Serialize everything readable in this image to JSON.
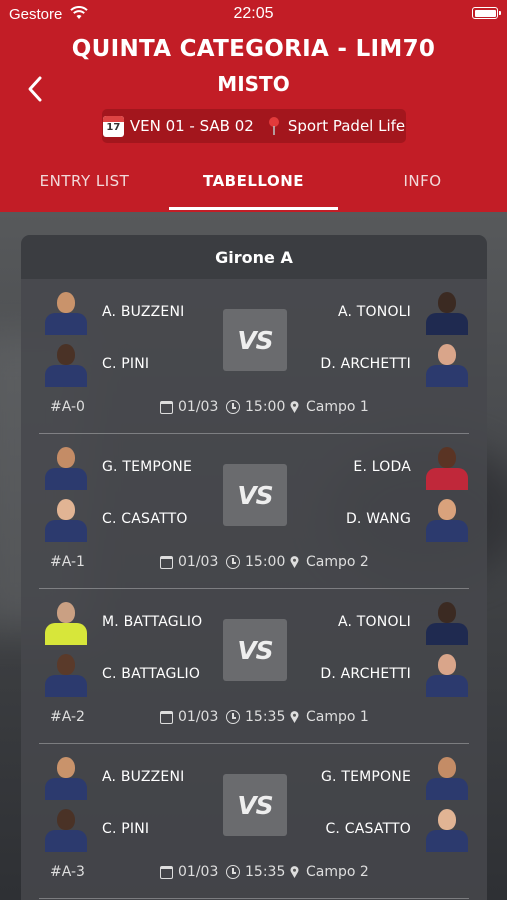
{
  "status": {
    "carrier": "Gestore",
    "time": "22:05"
  },
  "header": {
    "title": "QUINTA CATEGORIA - LIM70",
    "subtitle": "MISTO",
    "calendar_day": "17",
    "dates": "VEN 01 - SAB 02",
    "venue": "Sport Padel Life"
  },
  "tabs": [
    "ENTRY LIST",
    "TABELLONE",
    "INFO"
  ],
  "group": {
    "title": "Girone A"
  },
  "vs_label": "VS",
  "matches": [
    {
      "code": "#A-0",
      "date": "01/03",
      "time": "15:00",
      "court": "Campo 1",
      "left": [
        "A. BUZZENI",
        "C. PINI"
      ],
      "right": [
        "A. TONOLI",
        "D. ARCHETTI"
      ]
    },
    {
      "code": "#A-1",
      "date": "01/03",
      "time": "15:00",
      "court": "Campo 2",
      "left": [
        "G. TEMPONE",
        "C. CASATTO"
      ],
      "right": [
        "E. LODA",
        "D. WANG"
      ]
    },
    {
      "code": "#A-2",
      "date": "01/03",
      "time": "15:35",
      "court": "Campo 1",
      "left": [
        "M. BATTAGLIO",
        "C. BATTAGLIO"
      ],
      "right": [
        "A. TONOLI",
        "D. ARCHETTI"
      ]
    },
    {
      "code": "#A-3",
      "date": "01/03",
      "time": "15:35",
      "court": "Campo 2",
      "left": [
        "A. BUZZENI",
        "C. PINI"
      ],
      "right": [
        "G. TEMPONE",
        "C. CASATTO"
      ]
    }
  ],
  "colors": {
    "brand_red": "#c21d26",
    "pill_red": "#a3161d",
    "jersey": "#2c3a6e",
    "jersey_yellow": "#d7e63a"
  }
}
